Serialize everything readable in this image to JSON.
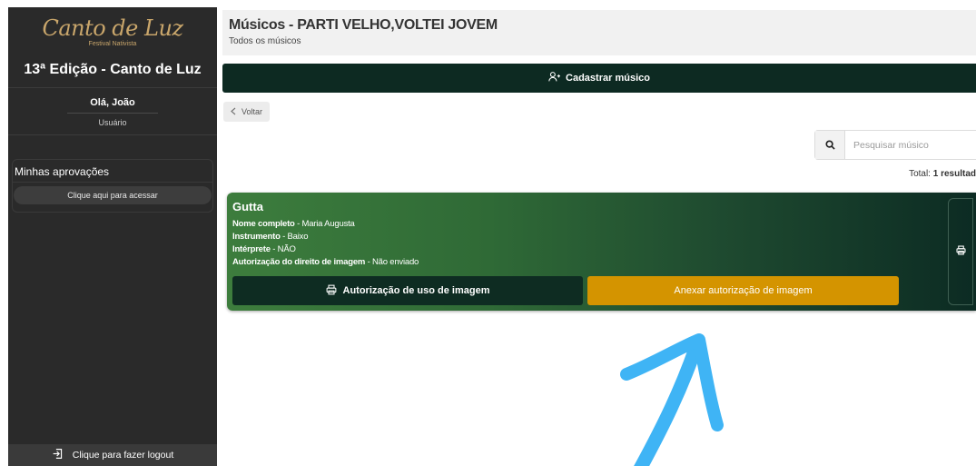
{
  "sidebar": {
    "logo_text": "Canto de Luz",
    "logo_sub": "Festival Nativista",
    "edition_title": "13ª Edição - Canto de Luz",
    "greeting": "Olá, João",
    "role": "Usuário",
    "approvals_title": "Minhas aprovações",
    "approvals_button": "Clique aqui para acessar",
    "logout_label": "Clique para fazer logout"
  },
  "header": {
    "title": "Músicos - PARTI VELHO,VOLTEI JOVEM",
    "subtitle": "Todos os músicos"
  },
  "actions": {
    "register_label": "Cadastrar músico",
    "back_label": "Voltar"
  },
  "search": {
    "placeholder": "Pesquisar músico",
    "icon": "search-icon"
  },
  "results": {
    "prefix": "Total: ",
    "count_text": "1 resultad"
  },
  "card": {
    "title": "Gutta",
    "fields": [
      {
        "label": "Nome completo",
        "value": " - Maria Augusta"
      },
      {
        "label": "Instrumento",
        "value": " - Baixo"
      },
      {
        "label": "Intérprete",
        "value": " - NÃO"
      },
      {
        "label": "Autorização do direito de imagem",
        "value": " - Não enviado"
      }
    ],
    "auth_button": "Autorização de uso de imagem",
    "attach_button": "Anexar autorização de imagem"
  },
  "colors": {
    "sidebar_bg": "#2a2a2a",
    "primary_dark": "#0d2a22",
    "card_green": "#3d7d3d",
    "accent_gold": "#d49400",
    "logo_gold": "#c9a66b",
    "annotation_arrow": "#3fb4f5"
  }
}
